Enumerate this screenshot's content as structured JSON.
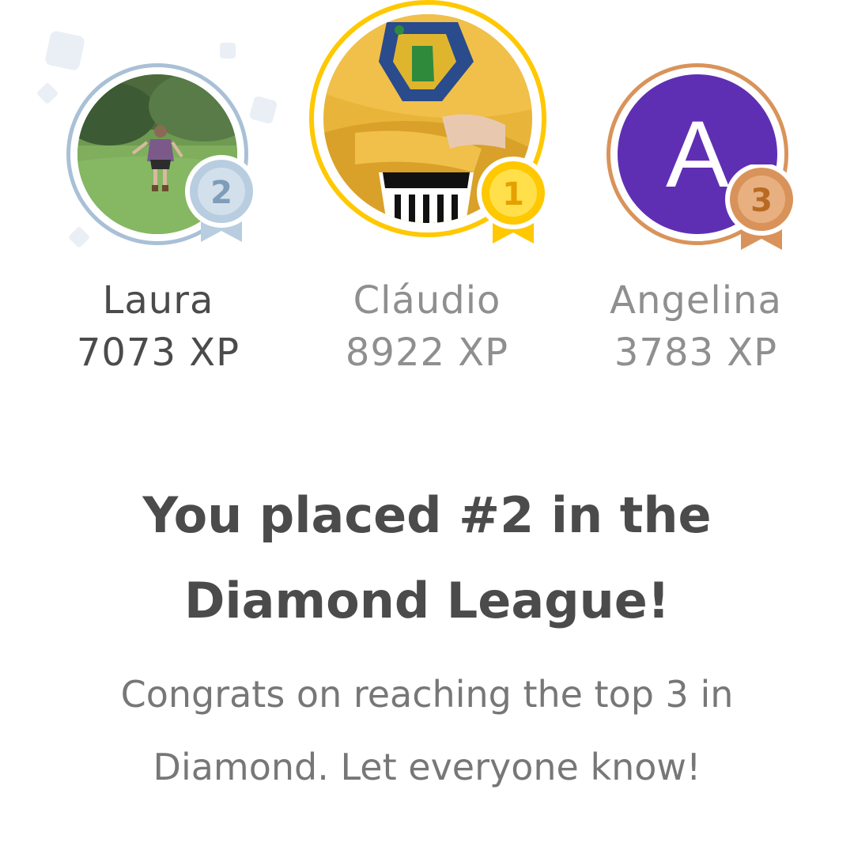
{
  "podium": [
    {
      "place": "2",
      "name": "Laura",
      "xp": "7073 XP",
      "ring_color": "#a9c0d6",
      "medal_color": "#b8cde0",
      "medal_text_color": "#7f9cb8",
      "is_current_user": true,
      "avatar": "photo-person-in-field"
    },
    {
      "place": "1",
      "name": "Cláudio",
      "xp": "8922 XP",
      "ring_color": "#ffc800",
      "medal_color": "#ffd900",
      "medal_text_color": "#e6a000",
      "is_current_user": false,
      "avatar": "photo-yellow-jersey"
    },
    {
      "place": "3",
      "name": "Angelina",
      "xp": "3783 XP",
      "ring_color": "#d9935a",
      "medal_color": "#e2a26a",
      "medal_text_color": "#b96a22",
      "is_current_user": false,
      "avatar_letter": "A",
      "avatar_bg": "#5f2fb3"
    }
  ],
  "headline": "You placed #2 in the Diamond League!",
  "subtext": "Congrats on reaching the top 3 in Diamond. Let everyone know!"
}
